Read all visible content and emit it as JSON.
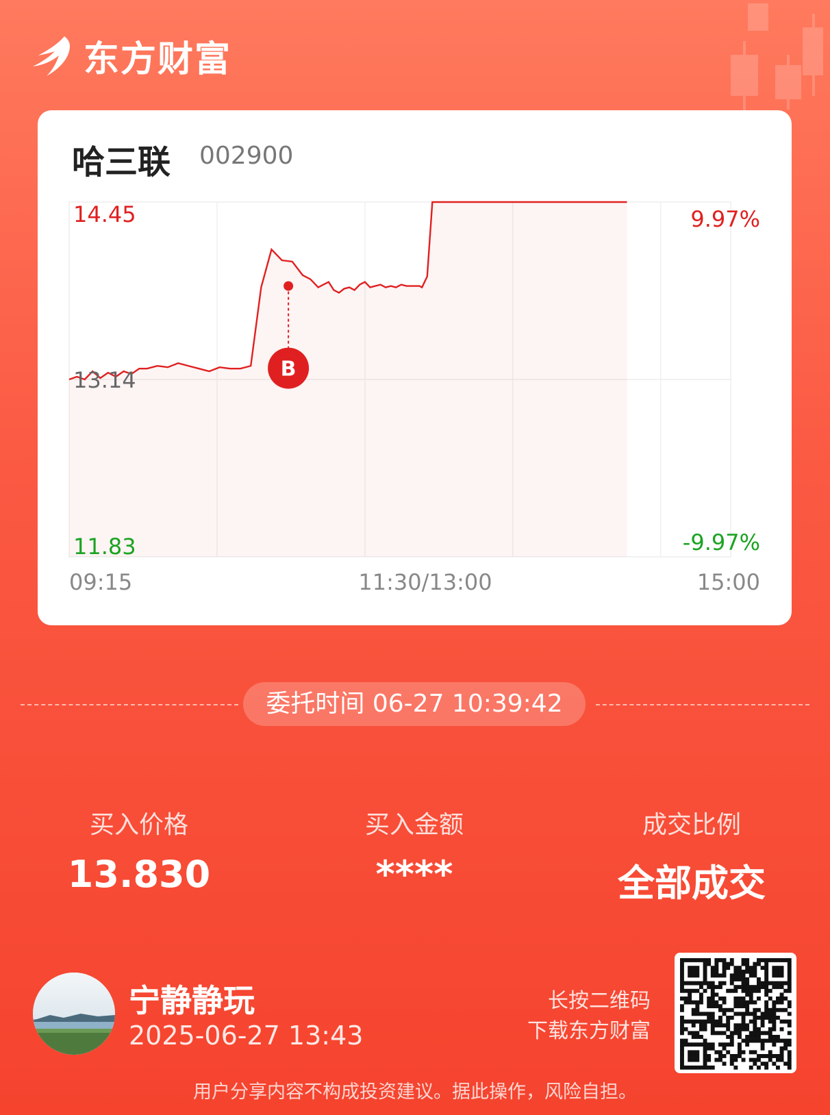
{
  "app": {
    "logo_text": "东方财富"
  },
  "stock": {
    "name": "哈三联",
    "code": "002900"
  },
  "chart_data": {
    "type": "line",
    "title": "",
    "price_labels": {
      "high": "14.45",
      "mid": "13.14",
      "low": "11.83"
    },
    "pct_labels": {
      "high": "9.97%",
      "low": "-9.97%"
    },
    "time_labels": [
      "09:15",
      "11:30/13:00",
      "15:00"
    ],
    "ylim": [
      11.83,
      14.45
    ],
    "x_unit": "minutes since 09:15 (session axis: 0=09:15, 135=11:30/13:00, 255=15:00)",
    "xlim": [
      0,
      255
    ],
    "series": [
      {
        "values_x": [
          0,
          3,
          6,
          9,
          12,
          15,
          18,
          21,
          24,
          27,
          30,
          34,
          38,
          42,
          46,
          50,
          54,
          58,
          62,
          66,
          70,
          74,
          78,
          82,
          86,
          90,
          93,
          96,
          98,
          100,
          102,
          104,
          106,
          108,
          110,
          112,
          114,
          116,
          118,
          120,
          122,
          124,
          126,
          128,
          130,
          132,
          134,
          135,
          136,
          138,
          140,
          142,
          145,
          150,
          160,
          170,
          180,
          190,
          200,
          210,
          215
        ],
        "values_y": [
          13.14,
          13.16,
          13.14,
          13.2,
          13.15,
          13.19,
          13.16,
          13.2,
          13.18,
          13.22,
          13.22,
          13.24,
          13.23,
          13.26,
          13.24,
          13.22,
          13.2,
          13.23,
          13.22,
          13.22,
          13.24,
          13.82,
          14.1,
          14.02,
          14.01,
          13.91,
          13.88,
          13.82,
          13.84,
          13.86,
          13.8,
          13.78,
          13.81,
          13.82,
          13.8,
          13.84,
          13.86,
          13.82,
          13.83,
          13.84,
          13.82,
          13.83,
          13.82,
          13.84,
          13.83,
          13.83,
          13.83,
          13.83,
          13.82,
          13.9,
          14.45,
          14.45,
          14.45,
          14.45,
          14.45,
          14.45,
          14.45,
          14.45,
          14.45,
          14.45,
          14.45
        ]
      }
    ],
    "marker": {
      "label": "B",
      "x": 84.5,
      "price": 13.83
    }
  },
  "order": {
    "label": "委托时间",
    "time": "06-27 10:39:42"
  },
  "metrics": [
    {
      "label": "买入价格",
      "value": "13.830"
    },
    {
      "label": "买入金额",
      "value": "****"
    },
    {
      "label": "成交比例",
      "value": "全部成交"
    }
  ],
  "user": {
    "name": "宁静静玩",
    "time": "2025-06-27 13:43"
  },
  "qr_tip": {
    "line1": "长按二维码",
    "line2": "下载东方财富"
  },
  "disclaimer": "用户分享内容不构成投资建议。据此操作，风险自担。",
  "colors": {
    "up": "#e02020",
    "down": "#1aa321",
    "brand": "#f5432e"
  },
  "icons": {
    "logo": "eastmoney-flame-icon",
    "qr": "qr-code-icon",
    "avatar": "landscape-avatar"
  }
}
